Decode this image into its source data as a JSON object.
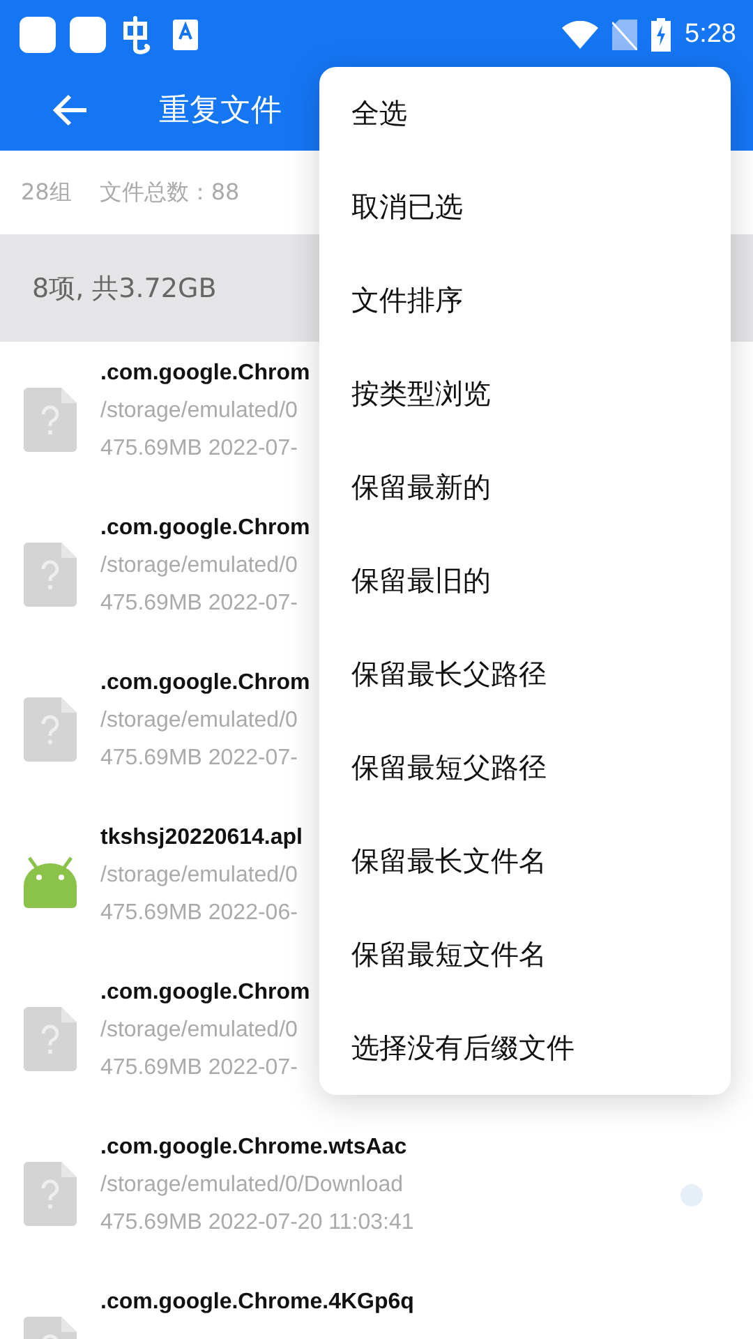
{
  "status_bar": {
    "time": "5:28"
  },
  "app_bar": {
    "title": "重复文件"
  },
  "summary": {
    "groups": "28组",
    "total": "文件总数：88"
  },
  "group": {
    "header": "8项, 共3.72GB"
  },
  "files": [
    {
      "kind": "unknown",
      "name": ".com.google.Chrom",
      "path": "/storage/emulated/0",
      "meta": "475.69MB  2022-07-"
    },
    {
      "kind": "unknown",
      "name": ".com.google.Chrom",
      "path": "/storage/emulated/0",
      "meta": "475.69MB  2022-07-"
    },
    {
      "kind": "unknown",
      "name": ".com.google.Chrom",
      "path": "/storage/emulated/0",
      "meta": "475.69MB  2022-07-"
    },
    {
      "kind": "apk",
      "name": "tkshsj20220614.apl",
      "path": "/storage/emulated/0",
      "meta": "475.69MB  2022-06-"
    },
    {
      "kind": "unknown",
      "name": ".com.google.Chrom",
      "path": "/storage/emulated/0",
      "meta": "475.69MB  2022-07-"
    },
    {
      "kind": "unknown",
      "name": ".com.google.Chrome.wtsAac",
      "path": "/storage/emulated/0/Download",
      "meta": "475.69MB  2022-07-20 11:03:41",
      "selected": false
    },
    {
      "kind": "unknown",
      "name": ".com.google.Chrome.4KGp6q"
    }
  ],
  "menu": {
    "items": [
      "全选",
      "取消已选",
      "文件排序",
      "按类型浏览",
      "保留最新的",
      "保留最旧的",
      "保留最长父路径",
      "保留最短父路径",
      "保留最长文件名",
      "保留最短文件名",
      "选择没有后缀文件"
    ]
  }
}
